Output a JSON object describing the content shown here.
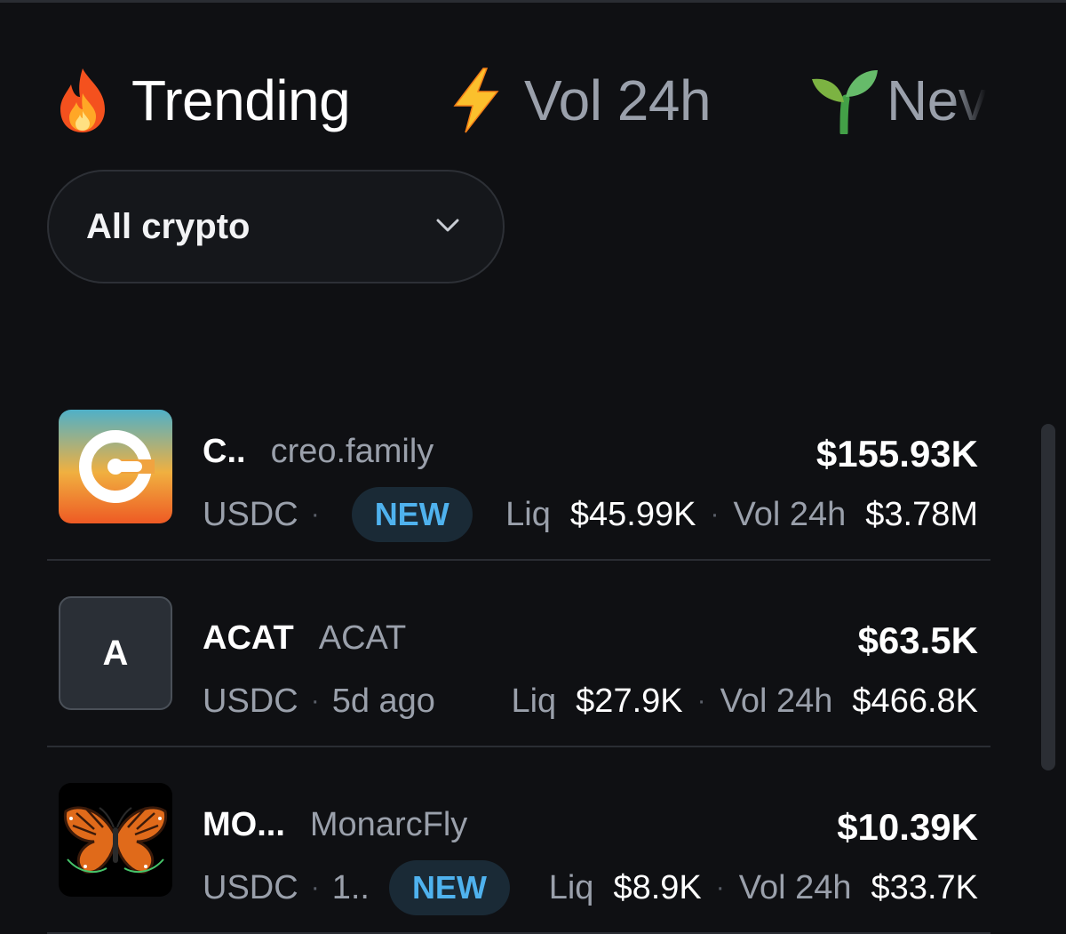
{
  "tabs": [
    {
      "label": "Trending",
      "icon": "fire-icon",
      "active": true
    },
    {
      "label": "Vol 24h",
      "icon": "lightning-icon",
      "active": false
    },
    {
      "label": "Nev",
      "icon": "seedling-icon",
      "active": false
    }
  ],
  "filter": {
    "label": "All crypto",
    "icon": "chevron-down-icon"
  },
  "tokens": [
    {
      "symbol": "C..",
      "name": "creo.family",
      "price": "$155.93K",
      "quote": "USDC",
      "age": "",
      "badge": "NEW",
      "liq_label": "Liq",
      "liq": "$45.99K",
      "vol_label": "Vol 24h",
      "vol": "$3.78M",
      "avatar": "creo-logo"
    },
    {
      "symbol": "ACAT",
      "name": "ACAT",
      "price": "$63.5K",
      "quote": "USDC",
      "age": "5d ago",
      "badge": "",
      "liq_label": "Liq",
      "liq": "$27.9K",
      "vol_label": "Vol 24h",
      "vol": "$466.8K",
      "avatar_letter": "A"
    },
    {
      "symbol": "MO...",
      "name": "MonarcFly",
      "price": "$10.39K",
      "quote": "USDC",
      "age": "1..",
      "badge": "NEW",
      "liq_label": "Liq",
      "liq": "$8.9K",
      "vol_label": "Vol 24h",
      "vol": "$33.7K",
      "avatar": "butterfly-image"
    }
  ],
  "colors": {
    "background": "#0f1013",
    "muted_text": "#9aa0ab",
    "badge_text": "#4fb2ee",
    "badge_bg": "#1a2a36"
  }
}
